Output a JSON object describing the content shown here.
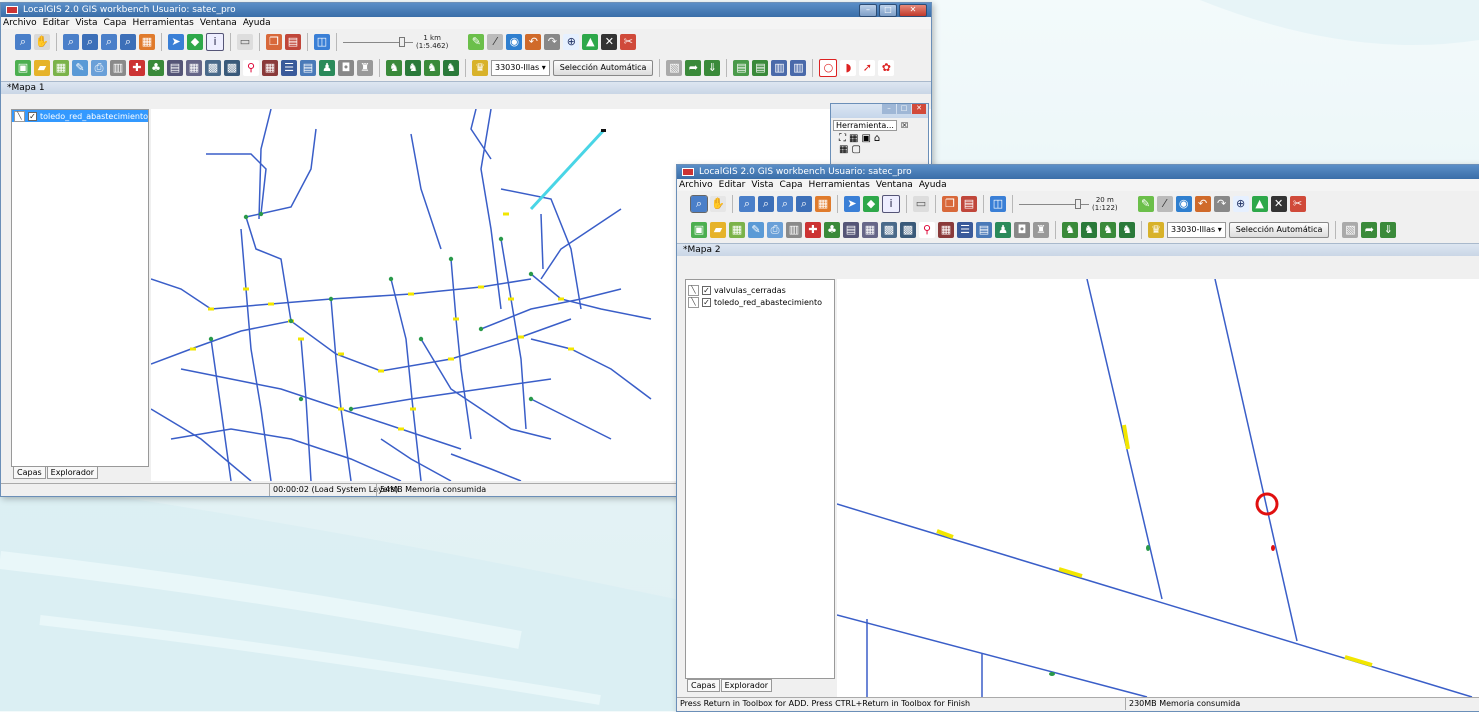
{
  "colors": {
    "line": "#3a5ec8",
    "valve": "#f2e600",
    "node": "#2a9a4a",
    "highlight": "#e01010",
    "cyan": "#49d5e6"
  },
  "win1": {
    "title": "LocalGIS 2.0 GIS workbench Usuario: satec_pro",
    "menu": [
      "Archivo",
      "Editar",
      "Vista",
      "Capa",
      "Herramientas",
      "Ventana",
      "Ayuda"
    ],
    "scale_line1": "1 km",
    "scale_line2": "(1:5.462)",
    "combo_value": "33030-Illas",
    "auto_button": "Selección Automática",
    "map_tab": "*Mapa 1",
    "layers": [
      "toledo_red_abastecimiento"
    ],
    "tabs": [
      "Capas",
      "Explorador"
    ],
    "float_title": "Herramienta...",
    "float_close": "☒",
    "status": [
      "00:00:02 (Load System Layers)",
      "54MB Memoria consumida"
    ]
  },
  "win2": {
    "title": "LocalGIS 2.0 GIS workbench Usuario: satec_pro",
    "menu": [
      "Archivo",
      "Editar",
      "Vista",
      "Capa",
      "Herramientas",
      "Ventana",
      "Ayuda"
    ],
    "scale_line1": "20 m",
    "scale_line2": "(1:122)",
    "combo_value": "33030-Illas",
    "auto_button": "Selección Automática",
    "map_tab": "*Mapa 2",
    "layers": [
      "valvulas_cerradas",
      "toledo_red_abastecimiento"
    ],
    "tabs": [
      "Capas",
      "Explorador"
    ],
    "status": [
      "Press Return in Toolbox for ADD. Press CTRL+Return  in Toolbox for Finish",
      "230MB Memoria consumida"
    ]
  },
  "icons": {
    "row1": [
      "zoom-in-icon",
      "pan-hand-icon",
      "zoom-icon",
      "zoom-out-icon",
      "zoom-area-icon",
      "zoom-prev-icon",
      "grid-icon",
      "select-icon",
      "layer-icon",
      "info-icon",
      "measure-icon",
      "copy-icon",
      "paste-icon",
      "properties-icon",
      "edit-icon",
      "draw-icon",
      "globe-icon",
      "undo-icon",
      "redo-icon",
      "compass-icon",
      "chart-icon",
      "close-x-icon",
      "cut-icon"
    ],
    "row2": [
      "save-icon",
      "folder-icon",
      "map-icon",
      "edit-doc-icon",
      "print-icon",
      "building-icon",
      "hospital-icon",
      "tree-icon",
      "table-icon",
      "grid-map-icon",
      "photo-icon",
      "photo2-icon",
      "pin-icon",
      "network-icon",
      "list-icon",
      "book-icon",
      "route-icon",
      "lock-icon",
      "stamp-icon",
      "pipe-icon",
      "valve-icon",
      "hydrant-icon",
      "tank-icon",
      "tool-icon"
    ]
  }
}
